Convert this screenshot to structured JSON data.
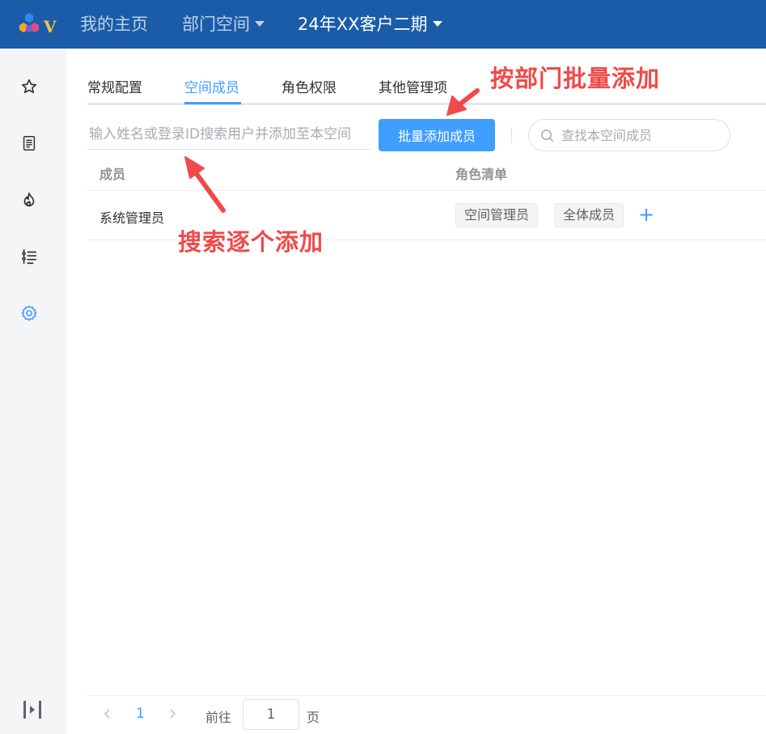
{
  "header": {
    "nav": [
      {
        "label": "我的主页"
      },
      {
        "label": "部门空间"
      },
      {
        "label": "24年XX客户二期"
      }
    ]
  },
  "sidebar": {
    "icons": [
      "star-icon",
      "document-icon",
      "fire-icon",
      "list-icon",
      "gear-icon"
    ],
    "active": "gear-icon",
    "collapse_icon": "collapse-icon"
  },
  "tabs": [
    {
      "label": "常规配置"
    },
    {
      "label": "空间成员"
    },
    {
      "label": "角色权限"
    },
    {
      "label": "其他管理项"
    }
  ],
  "active_tab": "空间成员",
  "toolbar": {
    "add_search_placeholder": "输入姓名或登录ID搜索用户并添加至本空间",
    "batch_add_label": "批量添加成员",
    "member_search_placeholder": "查找本空间成员"
  },
  "table": {
    "columns": [
      "成员",
      "角色清单"
    ],
    "rows": [
      {
        "member": "系统管理员",
        "roles": [
          "空间管理员",
          "全体成员"
        ]
      }
    ],
    "add_role_symbol": "+"
  },
  "pagination": {
    "current_page": "1",
    "goto_label": "前往",
    "goto_value": "1",
    "page_unit": "页"
  },
  "annotations": {
    "batch_note": "按部门批量添加",
    "search_note": "搜索逐个添加"
  },
  "colors": {
    "header_bg": "#1a5ca8",
    "accent": "#409eff",
    "annotation": "#f04a4a"
  }
}
